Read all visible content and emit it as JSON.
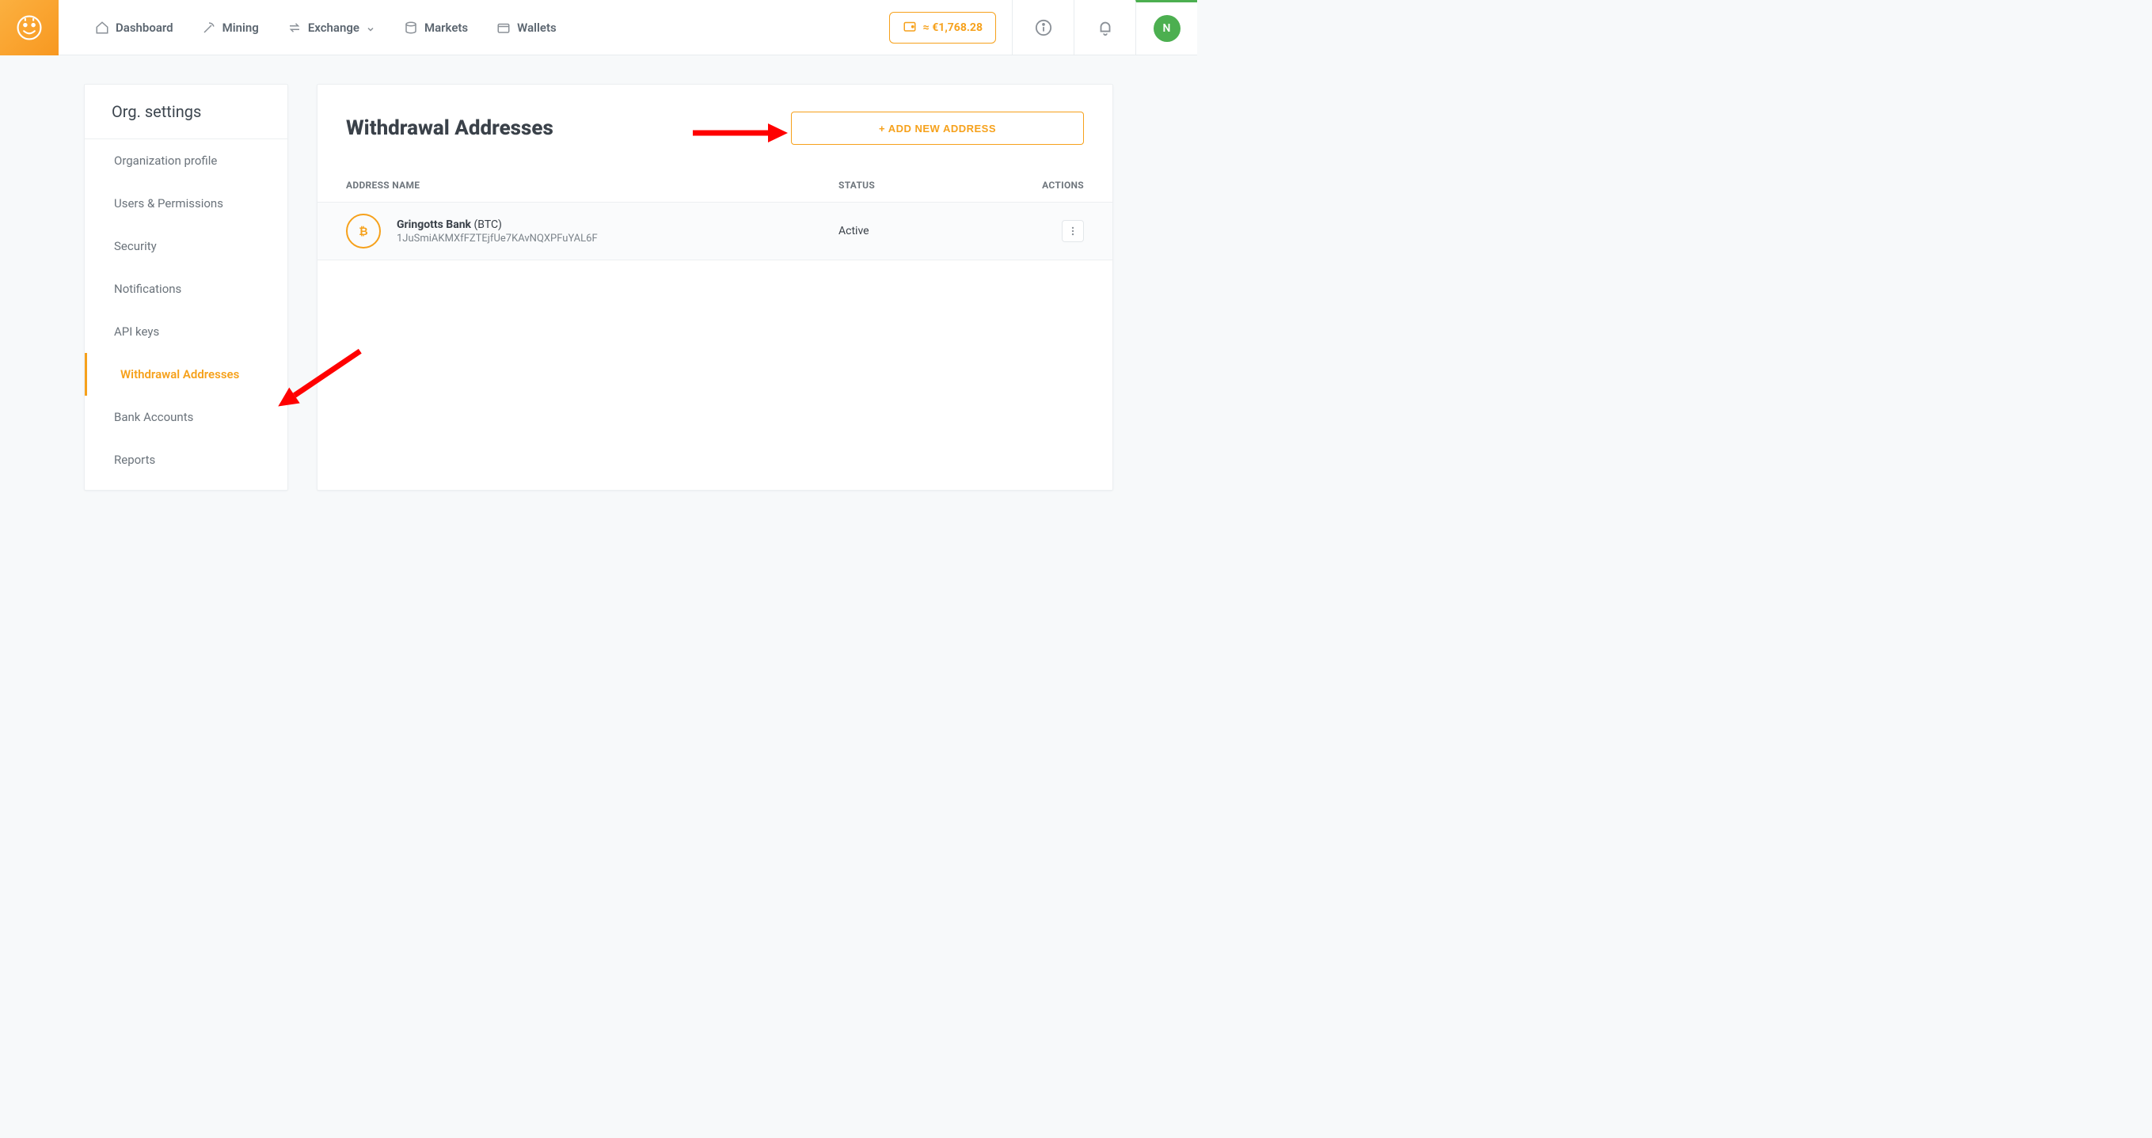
{
  "nav": {
    "items": [
      "Dashboard",
      "Mining",
      "Exchange",
      "Markets",
      "Wallets"
    ],
    "balance": "≈ €1,768.28",
    "avatar_initial": "N"
  },
  "sidebar": {
    "title": "Org. settings",
    "items": [
      "Organization profile",
      "Users & Permissions",
      "Security",
      "Notifications",
      "API keys",
      "Withdrawal Addresses",
      "Bank Accounts",
      "Reports"
    ],
    "active_index": 5
  },
  "main": {
    "title": "Withdrawal Addresses",
    "add_button": "+ ADD NEW ADDRESS",
    "columns": {
      "name": "ADDRESS NAME",
      "status": "STATUS",
      "actions": "ACTIONS"
    },
    "rows": [
      {
        "coin_symbol": "₿",
        "name": "Gringotts Bank",
        "currency": "(BTC)",
        "address": "1JuSmiAKMXfFZTEjfUe7KAvNQXPFuYAL6F",
        "status": "Active"
      }
    ]
  }
}
